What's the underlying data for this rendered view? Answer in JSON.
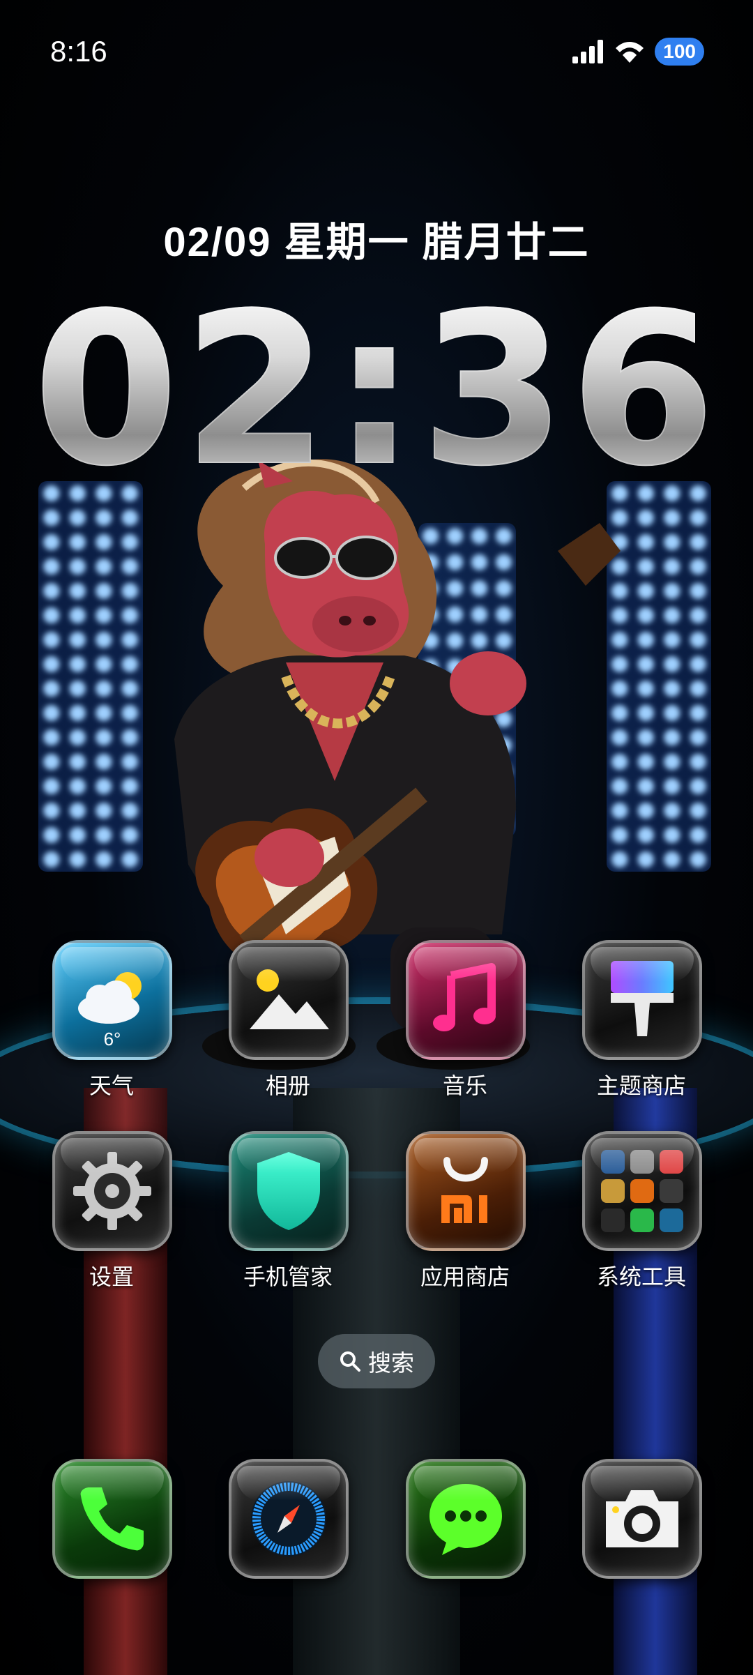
{
  "status_bar": {
    "time": "8:16",
    "battery": "100"
  },
  "lockscreen": {
    "date": "02/09 星期一 腊月廿二",
    "clock": "02:36"
  },
  "apps": [
    {
      "label": "天气",
      "icon": "weather-icon",
      "temp": "6°"
    },
    {
      "label": "相册",
      "icon": "gallery-icon"
    },
    {
      "label": "音乐",
      "icon": "music-icon"
    },
    {
      "label": "主题商店",
      "icon": "theme-store-icon"
    },
    {
      "label": "设置",
      "icon": "settings-gear-icon"
    },
    {
      "label": "手机管家",
      "icon": "security-shield-icon"
    },
    {
      "label": "应用商店",
      "icon": "app-store-icon"
    },
    {
      "label": "系统工具",
      "icon": "system-tools-folder-icon"
    }
  ],
  "search": {
    "label": "搜索"
  },
  "dock": [
    {
      "icon": "phone-icon"
    },
    {
      "icon": "browser-compass-icon"
    },
    {
      "icon": "messages-icon"
    },
    {
      "icon": "camera-icon"
    }
  ],
  "colors": {
    "battery_badge": "#2f7ff0",
    "stage_light": "#3a8dff",
    "pedestal_glow": "#28c8ff"
  }
}
